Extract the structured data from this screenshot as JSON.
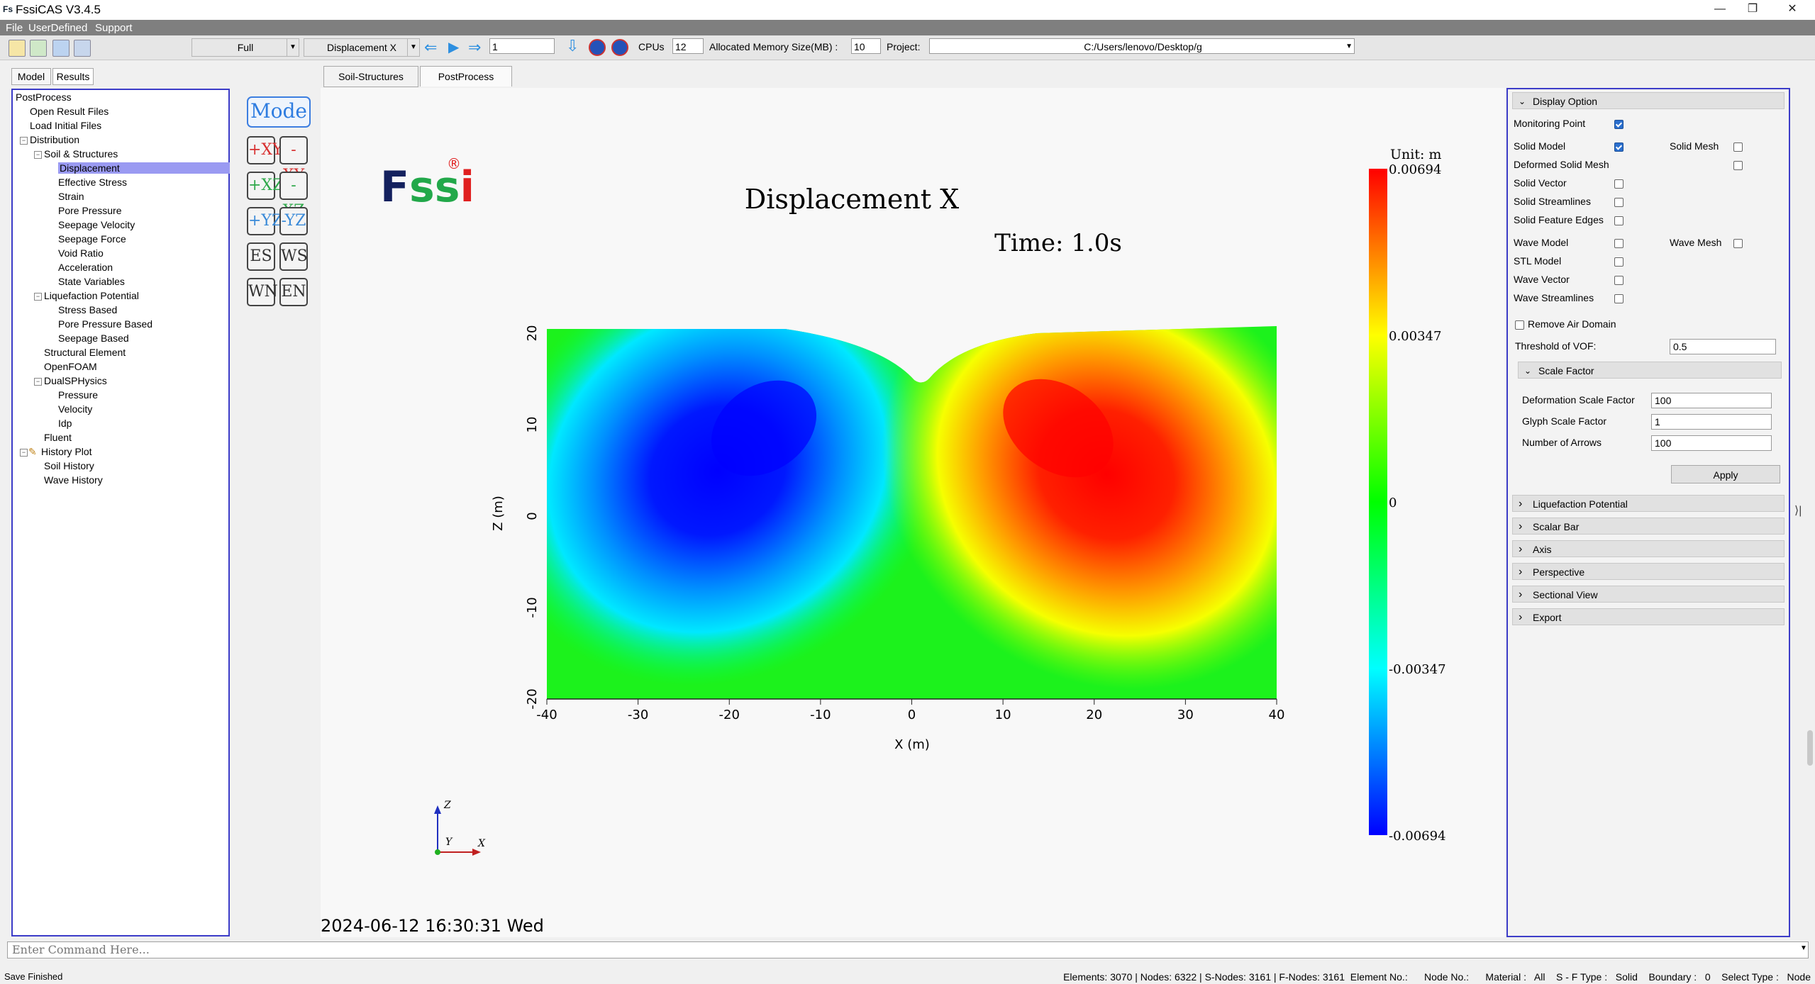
{
  "window": {
    "title": "FssiCAS V3.4.5",
    "icon_text": "Fs"
  },
  "menu": [
    "File",
    "UserDefined",
    "Support"
  ],
  "toolbar": {
    "view_mode": "Full",
    "result_field": "Displacement X",
    "step_value": "1",
    "cpus_label": "CPUs",
    "cpus_value": "12",
    "memory_label": "Allocated Memory Size(MB) :",
    "memory_value": "10",
    "project_label": "Project:",
    "project_path": "C:/Users/lenovo/Desktop/g"
  },
  "left_tabs": [
    "Model",
    "Results"
  ],
  "tree": [
    {
      "label": "PostProcess",
      "level": 0
    },
    {
      "label": "Open Result Files",
      "level": 1
    },
    {
      "label": "Load Initial Files",
      "level": 1
    },
    {
      "label": "Distribution",
      "level": 1,
      "exp": true
    },
    {
      "label": "Soil & Structures",
      "level": 2,
      "exp": true
    },
    {
      "label": "Displacement",
      "level": 3,
      "selected": true
    },
    {
      "label": "Effective Stress",
      "level": 3
    },
    {
      "label": "Strain",
      "level": 3
    },
    {
      "label": "Pore Pressure",
      "level": 3
    },
    {
      "label": "Seepage Velocity",
      "level": 3
    },
    {
      "label": "Seepage Force",
      "level": 3
    },
    {
      "label": "Void Ratio",
      "level": 3
    },
    {
      "label": "Acceleration",
      "level": 3
    },
    {
      "label": "State Variables",
      "level": 3
    },
    {
      "label": "Liquefaction Potential",
      "level": 2,
      "exp": true
    },
    {
      "label": "Stress Based",
      "level": 3
    },
    {
      "label": "Pore Pressure Based",
      "level": 3
    },
    {
      "label": "Seepage Based",
      "level": 3
    },
    {
      "label": "Structural Element",
      "level": 2
    },
    {
      "label": "OpenFOAM",
      "level": 2
    },
    {
      "label": "DualSPHysics",
      "level": 2,
      "exp": true
    },
    {
      "label": "Pressure",
      "level": 3
    },
    {
      "label": "Velocity",
      "level": 3
    },
    {
      "label": "Idp",
      "level": 3
    },
    {
      "label": "Fluent",
      "level": 2
    },
    {
      "label": "History Plot",
      "level": 1,
      "exp": true,
      "pencil": true
    },
    {
      "label": "Soil History",
      "level": 2
    },
    {
      "label": "Wave History",
      "level": 2
    }
  ],
  "view_buttons": {
    "mode": "Mode",
    "views": [
      [
        "+XY",
        "-XY"
      ],
      [
        "+XZ",
        "-XZ"
      ],
      [
        "+YZ",
        "-YZ"
      ],
      [
        "ES",
        "WS"
      ],
      [
        "WN",
        "EN"
      ]
    ]
  },
  "viewer_tabs": [
    "Soil-Structures",
    "PostProcess"
  ],
  "logo": {
    "text": "Fssi",
    "mark": "®"
  },
  "plot": {
    "title": "Displacement X",
    "time": "Time: 1.0s",
    "xlabel": "X (m)",
    "ylabel": "Z (m)",
    "xticks": [
      "-40",
      "-30",
      "-20",
      "-10",
      "0",
      "10",
      "20",
      "30",
      "40"
    ],
    "zticks": [
      "20",
      "10",
      "0",
      "-10",
      "-20"
    ],
    "unit_label": "Unit:   m",
    "colorbar_ticks": [
      "0.00694",
      "0.00347",
      "0",
      "-0.00347",
      "-0.00694"
    ],
    "colors": {
      "max": "#ff0000",
      "mid": "#00ff00",
      "min": "#0000ff"
    },
    "axis_triad": {
      "z": "Z",
      "y": "Y",
      "x": "X"
    },
    "timestamp": "2024-06-12 16:30:31 Wed"
  },
  "chart_data": {
    "type": "heatmap",
    "title": "Displacement X",
    "subtitle": "Time: 1.0s",
    "xlabel": "X (m)",
    "ylabel": "Z (m)",
    "xlim": [
      -40,
      40
    ],
    "ylim": [
      -20,
      20
    ],
    "colorbar": {
      "unit": "m",
      "min": -0.00694,
      "max": 0.00694,
      "ticks": [
        0.00694,
        0.00347,
        0,
        -0.00347,
        -0.00694
      ]
    },
    "extrema": [
      {
        "value": -0.00694,
        "x": -15,
        "z": 5
      },
      {
        "value": 0.00694,
        "x": 15,
        "z": 7
      }
    ]
  },
  "right_panel": {
    "display_option": "Display Option",
    "checks": [
      {
        "label": "Monitoring Point",
        "checked": true
      },
      {
        "label": "Solid Model",
        "checked": true,
        "label2": "Solid Mesh",
        "checked2": false
      },
      {
        "label": "Deformed Solid Mesh",
        "checked": false,
        "far": true
      },
      {
        "label": "Solid Vector",
        "checked": false
      },
      {
        "label": "Solid Streamlines",
        "checked": false
      },
      {
        "label": "Solid Feature Edges",
        "checked": false
      },
      {
        "label": "Wave Model",
        "checked": false,
        "label2": "Wave Mesh",
        "checked2": false
      },
      {
        "label": "STL Model",
        "checked": false
      },
      {
        "label": "Wave Vector",
        "checked": false
      },
      {
        "label": "Wave Streamlines",
        "checked": false
      }
    ],
    "remove_air": "Remove Air Domain",
    "threshold_label": "Threshold of VOF:",
    "threshold_value": "0.5",
    "scale_factor": "Scale Factor",
    "deform_label": "Deformation Scale Factor",
    "deform_value": "100",
    "glyph_label": "Glyph Scale Factor",
    "glyph_value": "1",
    "arrows_label": "Number of Arrows",
    "arrows_value": "100",
    "apply": "Apply",
    "sections": [
      "Liquefaction Potential",
      "Scalar Bar",
      "Axis",
      "Perspective",
      "Sectional View",
      "Export"
    ]
  },
  "command": {
    "placeholder": "Enter Command Here..."
  },
  "status": {
    "left": "Save Finished",
    "right": "Elements: 3070 | Nodes: 6322 | S-Nodes: 3161 | F-Nodes: 3161  Element No.:      Node No.:      Material :   All    S - F Type :   Solid    Boundary :   0    Select Type :   Node"
  }
}
